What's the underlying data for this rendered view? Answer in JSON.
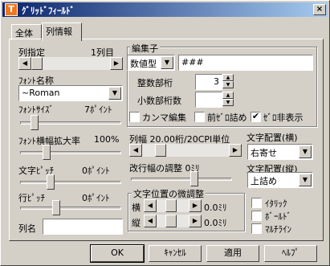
{
  "window": {
    "title": "ｸﾞﾘｯﾄﾞﾌｨｰﾙﾄﾞ",
    "icon_letter": "T",
    "close": "×"
  },
  "tabs": [
    {
      "label": "全体"
    },
    {
      "label": "列情報"
    }
  ],
  "column_select": {
    "label": "列指定",
    "value": "1列目"
  },
  "font": {
    "label": "ﾌｫﾝﾄ名称",
    "value": "~Roman"
  },
  "font_size": {
    "label": "ﾌｫﾝﾄｻｲｽﾞ",
    "value": "7ﾎﾟｲﾝﾄ"
  },
  "font_width": {
    "label": "ﾌｫﾝﾄ横幅拡大率",
    "value": "100%"
  },
  "char_pitch": {
    "label": "文字ﾋﾟｯﾁ",
    "value": "0ﾎﾟｲﾝﾄ"
  },
  "line_pitch": {
    "label": "行ﾋﾟｯﾁ",
    "value": "0ﾎﾟｲﾝﾄ"
  },
  "column_name": {
    "label": "列名",
    "value": ""
  },
  "editor": {
    "legend": "編集子",
    "type_value": "数値型",
    "format_value": "###",
    "int_digits": {
      "label": "整数部桁",
      "value": "3"
    },
    "dec_digits": {
      "label": "小数部桁数",
      "value": ""
    },
    "comma": {
      "label": "カンマ編集",
      "checked": false
    },
    "zero_pad": {
      "label": "前ｾﾞﾛ詰め",
      "checked": false
    },
    "zero_hide": {
      "label": "ｾﾞﾛ非表示",
      "checked": true
    }
  },
  "column_width": {
    "label": "列幅 20.00桁/20CPI単位"
  },
  "wrap_adjust": {
    "label": "改行幅の調整 0ﾐﾘ"
  },
  "fine_adjust": {
    "legend": "文字位置の微調整",
    "horizontal": {
      "label": "横",
      "value": "0.0ﾐﾘ"
    },
    "vertical": {
      "label": "縦",
      "value": "0.0ﾐﾘ"
    }
  },
  "align_h": {
    "label": "文字配置(横)",
    "value": "右寄せ"
  },
  "align_v": {
    "label": "文字配置(縦)",
    "value": "上詰め"
  },
  "options": {
    "italic": "ｲﾀﾘｯｸ",
    "bold": "ﾎﾞｰﾙﾄﾞ",
    "multiline": "ﾏﾙﾁﾗｲﾝ"
  },
  "buttons": {
    "ok": "OK",
    "cancel": "ｷｬﾝｾﾙ",
    "apply": "適用",
    "help": "ﾍﾙﾌﾟ"
  },
  "glyphs": {
    "arrow_left": "◀",
    "arrow_right": "▶",
    "arrow_down": "▼",
    "spin_up": "▲",
    "spin_down": "▼",
    "check": "✔"
  }
}
